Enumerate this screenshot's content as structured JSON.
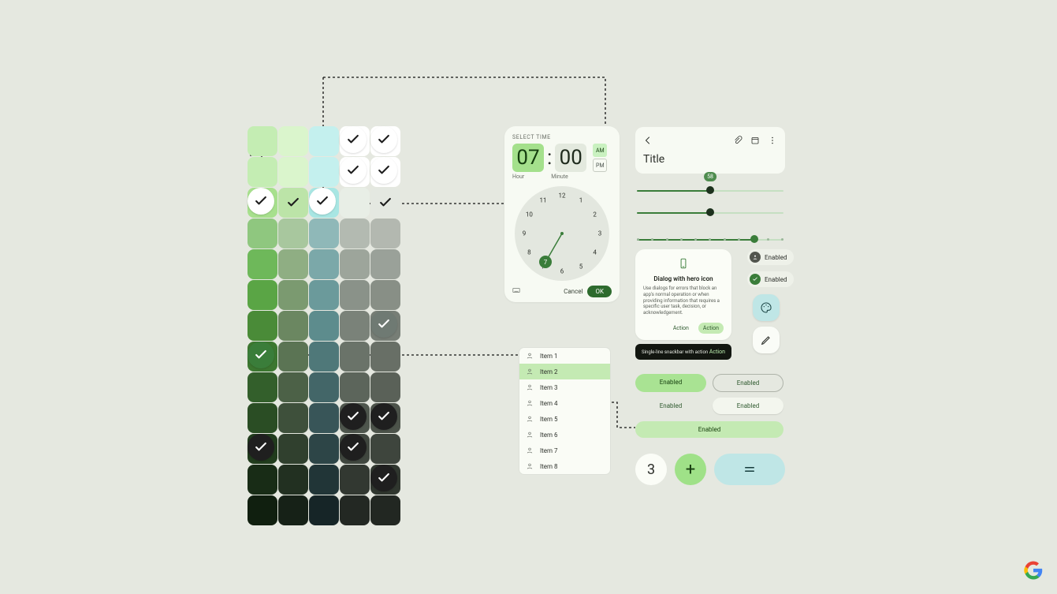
{
  "palette": {
    "colors": [
      [
        "#c4edb3",
        "#daf5cc",
        "#c4f0ee",
        "#ffffff",
        "#ffffff"
      ],
      [
        "#c4edb3",
        "#daf5cc",
        "#c4f0ee",
        "#ffffff",
        "#ffffff"
      ],
      [
        "#a7e08d",
        "#bce4a8",
        "#a8e6e3",
        "#e8eee6",
        "#e4e8e1"
      ],
      [
        "#8fc77f",
        "#a8c79e",
        "#8fb8b8",
        "#b3bab1",
        "#b3b8b0"
      ],
      [
        "#6eb85a",
        "#8fae83",
        "#7ba8a9",
        "#9da59b",
        "#9aa199"
      ],
      [
        "#5aa545",
        "#7b9a70",
        "#6b9a9b",
        "#8a9289",
        "#888f86"
      ],
      [
        "#4a8b38",
        "#6b8761",
        "#5d8c8d",
        "#7a8279",
        "#777e76"
      ],
      [
        "#3c7730",
        "#5b7454",
        "#4f7879",
        "#6a7369",
        "#686f66"
      ],
      [
        "#335f2b",
        "#4c6147",
        "#436668",
        "#5c655b",
        "#5a6158"
      ],
      [
        "#2a4d24",
        "#3e503b",
        "#385558",
        "#4e564d",
        "#4c534a"
      ],
      [
        "#213c1d",
        "#30402e",
        "#2d4547",
        "#40473f",
        "#3e453d"
      ],
      [
        "#182c16",
        "#223021",
        "#213537",
        "#323831",
        "#30372f"
      ],
      [
        "#101f0f",
        "#162117",
        "#162527",
        "#232823",
        "#222722"
      ]
    ],
    "checks": [
      {
        "r": 0,
        "c": 3,
        "style": "circle white",
        "stroke": "#1d1d1d"
      },
      {
        "r": 0,
        "c": 4,
        "style": "circle white",
        "stroke": "#1d1d1d"
      },
      {
        "r": 1,
        "c": 3,
        "style": "circle white",
        "stroke": "#1d1d1d"
      },
      {
        "r": 1,
        "c": 4,
        "style": "circle white",
        "stroke": "#1d1d1d"
      },
      {
        "r": 2,
        "c": 0,
        "style": "circle white",
        "stroke": "#1d1d1d"
      },
      {
        "r": 2,
        "c": 1,
        "style": "plain",
        "stroke": "#1d1d1d"
      },
      {
        "r": 2,
        "c": 2,
        "style": "circle white",
        "stroke": "#1d1d1d"
      },
      {
        "r": 2,
        "c": 4,
        "style": "plain",
        "stroke": "#1d1d1d"
      },
      {
        "r": 6,
        "c": 4,
        "style": "circle gray",
        "stroke": "#ffffff"
      },
      {
        "r": 7,
        "c": 0,
        "style": "circle green",
        "stroke": "#ffffff"
      },
      {
        "r": 9,
        "c": 3,
        "style": "circle dark",
        "stroke": "#ffffff"
      },
      {
        "r": 9,
        "c": 4,
        "style": "circle dark",
        "stroke": "#ffffff"
      },
      {
        "r": 10,
        "c": 0,
        "style": "circle dark",
        "stroke": "#ffffff"
      },
      {
        "r": 10,
        "c": 3,
        "style": "circle dark",
        "stroke": "#ffffff"
      },
      {
        "r": 11,
        "c": 4,
        "style": "circle dark",
        "stroke": "#ffffff"
      }
    ]
  },
  "timepicker": {
    "label": "SELECT TIME",
    "hour": "07",
    "minute": "00",
    "hourLabel": "Hour",
    "minuteLabel": "Minute",
    "am": "AM",
    "pm": "PM",
    "selectedPeriod": "AM",
    "numbers": [
      "12",
      "1",
      "2",
      "3",
      "4",
      "5",
      "6",
      "7",
      "8",
      "9",
      "10",
      "11"
    ],
    "selected": 7,
    "cancel": "Cancel",
    "ok": "OK"
  },
  "list": {
    "items": [
      "Item 1",
      "Item 2",
      "Item 3",
      "Item 4",
      "Item 5",
      "Item 6",
      "Item 7",
      "Item 8"
    ],
    "selectedIndex": 1
  },
  "topbar": {
    "title": "Title"
  },
  "sliders": {
    "a": {
      "value": 58,
      "max": 100
    },
    "b": {
      "value": 50,
      "max": 100
    },
    "c": {
      "value": 80,
      "max": 100,
      "ticks": 11
    }
  },
  "dialog": {
    "title": "Dialog with hero icon",
    "body": "Use dialogs for errors that block an app's normal operation or when providing information that requires a specific user task, decision, or acknowledgement.",
    "action1": "Action",
    "action2": "Action"
  },
  "chips": {
    "a": "Enabled",
    "b": "Enabled"
  },
  "snackbar": {
    "text": "Single-line snackbar with action",
    "action": "Action"
  },
  "buttons": {
    "filled": "Enabled",
    "outlined": "Enabled",
    "text": "Enabled",
    "elevated": "Enabled",
    "wide": "Enabled"
  },
  "calc": {
    "num": "3"
  }
}
